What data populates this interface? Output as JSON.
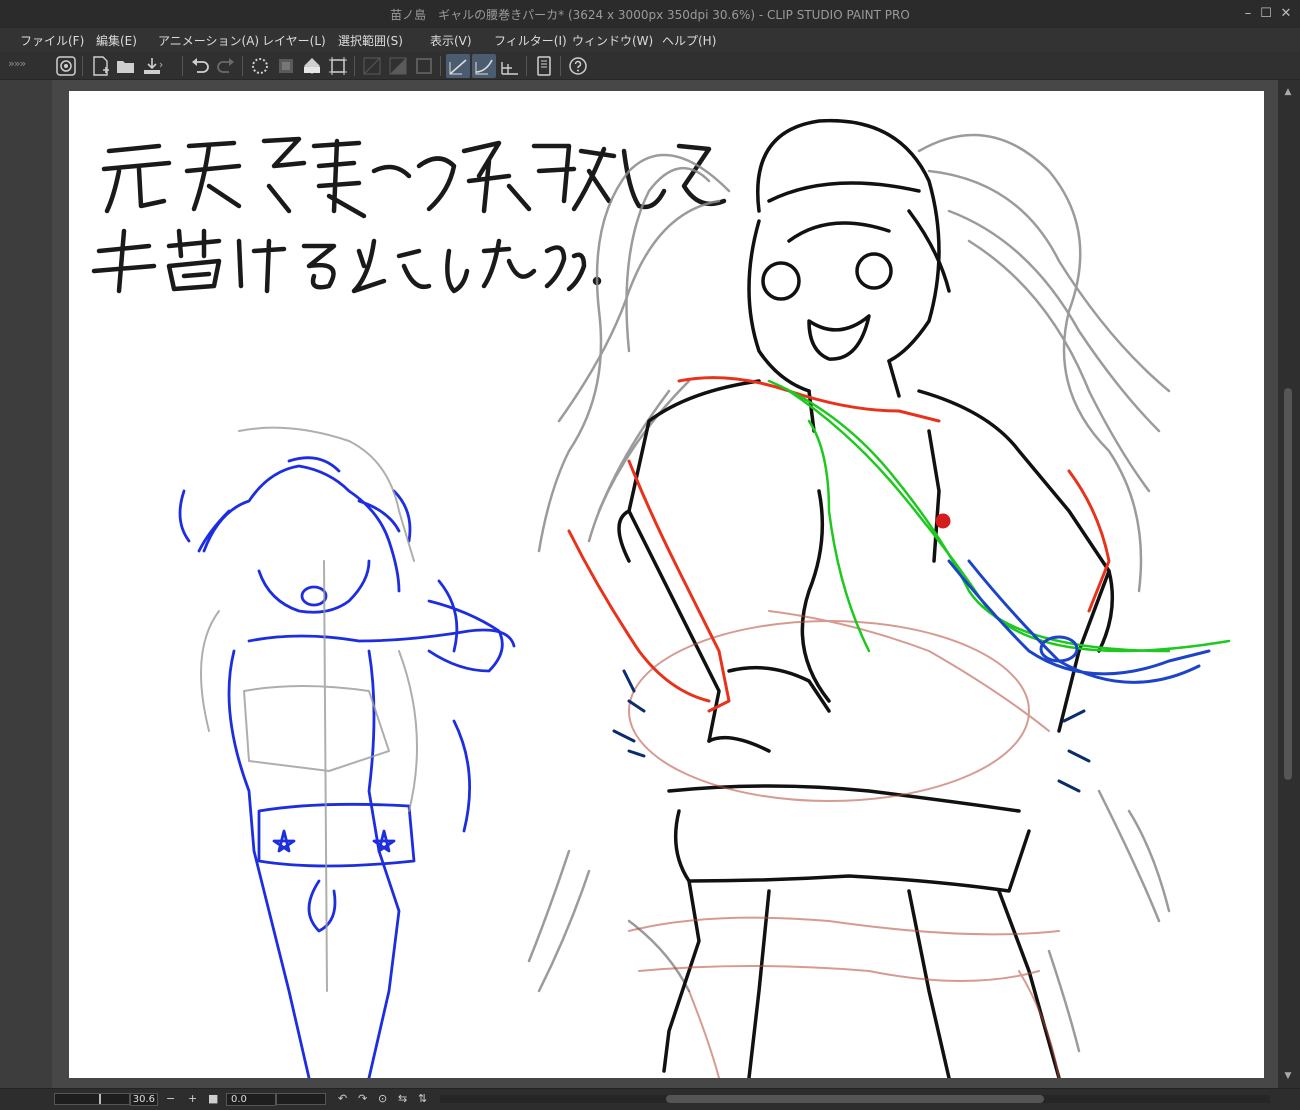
{
  "window": {
    "title": "苗ノ島　ギャルの腰巻きパーカ* (3624 x 3000px 350dpi 30.6%)  - CLIP STUDIO PAINT PRO"
  },
  "menu": {
    "items": [
      {
        "label": "ファイル(F)"
      },
      {
        "label": "編集(E)"
      },
      {
        "label": "アニメーション(A)"
      },
      {
        "label": "レイヤー(L)"
      },
      {
        "label": "選択範囲(S)"
      },
      {
        "label": "表示(V)"
      },
      {
        "label": "フィルター(I)"
      },
      {
        "label": "ウィンドウ(W)"
      },
      {
        "label": "ヘルプ(H)"
      }
    ]
  },
  "toolbar": {
    "collapse_glyph": "»»»",
    "tools": [
      {
        "icon": "clip-studio-icon"
      },
      {
        "icon": "new-file-icon"
      },
      {
        "icon": "open-folder-icon"
      },
      {
        "icon": "save-icon"
      },
      {
        "icon": "undo-icon"
      },
      {
        "icon": "redo-icon"
      },
      {
        "icon": "loading-spinner-icon"
      },
      {
        "icon": "clear-icon"
      },
      {
        "icon": "fill-icon"
      },
      {
        "icon": "transform-icon"
      },
      {
        "icon": "ruler-icon"
      },
      {
        "icon": "snap-ruler-icon",
        "active": true
      },
      {
        "icon": "snap-special-ruler-icon",
        "active": true
      },
      {
        "icon": "snap-grid-icon"
      },
      {
        "icon": "tablet-icon"
      },
      {
        "icon": "help-icon"
      }
    ]
  },
  "canvas": {
    "handwritten_text": [
      "元気張って勉強して",
      "描けるようになろう"
    ]
  },
  "statusbar": {
    "zoom_value": "30.6",
    "zoom_out": "−",
    "zoom_in": "+",
    "rotation_value": "0.0"
  }
}
